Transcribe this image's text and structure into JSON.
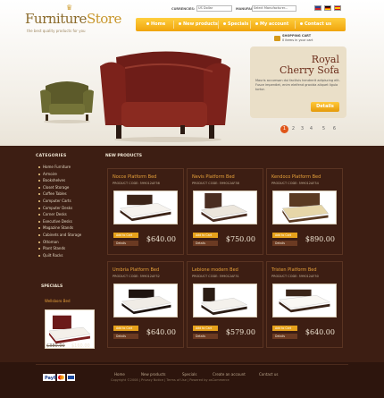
{
  "header": {
    "logo_main": "Furniture",
    "logo_store": "Store",
    "tagline": "the best quality products for you",
    "currencies_label": "CURRENCIES:",
    "currency_value": "US Dollar",
    "manufacturers_label": "MANUFACTURERS:",
    "manufacturer_value": "Select Manufacturer..."
  },
  "nav": {
    "items": [
      "Home",
      "New products",
      "Specials",
      "My account",
      "Contact us"
    ]
  },
  "cart": {
    "line1": "SHOPPING CART",
    "line2": "0 items in your cart"
  },
  "promo": {
    "title1": "Royal",
    "title2": "Cherry Sofa",
    "text": "Mauris accumsan dui facilisis hendrerit adipiscing elit. Fusce imperdiet, enim eleifend gravida aliquet ligula tortor.",
    "button": "Details"
  },
  "pagination": {
    "pages": [
      "1",
      "2",
      "3",
      "4",
      "5",
      "6"
    ],
    "active": 0
  },
  "sidebar": {
    "categories_title": "CATEGORIES",
    "categories": [
      "Home Furniture",
      "Armoire",
      "Bookshelves",
      "Closet Storage",
      "Coffee Tables",
      "Computer Carts",
      "Computer Desks",
      "Corner Desks",
      "Executive Desks",
      "Magazine Stands",
      "Cabinets and Storage",
      "Ottoman",
      "Plant Stands",
      "Quilt Racks"
    ],
    "specials_title": "SPECIALS",
    "special_name": "Wellsboro Bed",
    "special_old": "$380.00",
    "special_new": "$160.00"
  },
  "main": {
    "title": "NEW PRODUCTS",
    "products": [
      {
        "name": "Nocce Platform Bed",
        "code": "PRODUCT CODE: 599012AF36",
        "price": "$640.00"
      },
      {
        "name": "Nevis Platform Bed",
        "code": "PRODUCT CODE: 599012AF38",
        "price": "$750.00"
      },
      {
        "name": "Kendoco Platform Bed",
        "code": "PRODUCT CODE: 599012AF34",
        "price": "$890.00"
      },
      {
        "name": "Umbria Platform Bed",
        "code": "PRODUCT CODE: 599012AF32",
        "price": "$640.00"
      },
      {
        "name": "Lebione modern Bed",
        "code": "PRODUCT CODE: 599012AF31",
        "price": "$579.00"
      },
      {
        "name": "Tristen Platform Bed",
        "code": "PRODUCT CODE: 599012AF30",
        "price": "$640.00"
      }
    ],
    "add_to_cart": "Add to Cart",
    "details": "Details"
  },
  "footer": {
    "links": [
      "Home",
      "New products",
      "Specials",
      "Create an account",
      "Contact us"
    ],
    "copyright": "Copyright ©2008 | Privacy Notice | Terms of Use | Powered by osCommerce"
  },
  "colors": {
    "accent": "#f0a40c",
    "brand": "#3d1e13",
    "price": "#f0e6d4"
  }
}
